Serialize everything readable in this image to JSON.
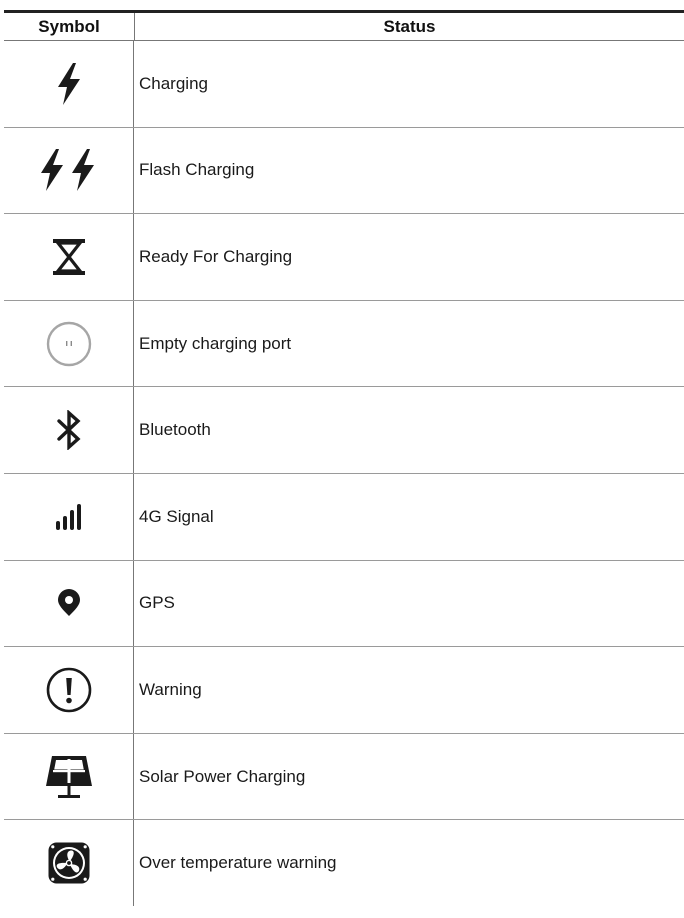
{
  "table": {
    "header": {
      "symbol": "Symbol",
      "status": "Status"
    },
    "rows": [
      {
        "icon": "lightning-bolt-icon",
        "status": "Charging"
      },
      {
        "icon": "double-lightning-bolt-icon",
        "status": "Flash Charging"
      },
      {
        "icon": "hourglass-icon",
        "status": "Ready For Charging"
      },
      {
        "icon": "empty-port-icon",
        "status": "Empty charging port"
      },
      {
        "icon": "bluetooth-icon",
        "status": "Bluetooth"
      },
      {
        "icon": "signal-bars-icon",
        "status": "4G Signal"
      },
      {
        "icon": "location-pin-icon",
        "status": "GPS"
      },
      {
        "icon": "warning-icon",
        "status": "Warning"
      },
      {
        "icon": "solar-panel-icon",
        "status": "Solar Power Charging"
      },
      {
        "icon": "fan-icon",
        "status": "Over temperature warning"
      }
    ]
  }
}
